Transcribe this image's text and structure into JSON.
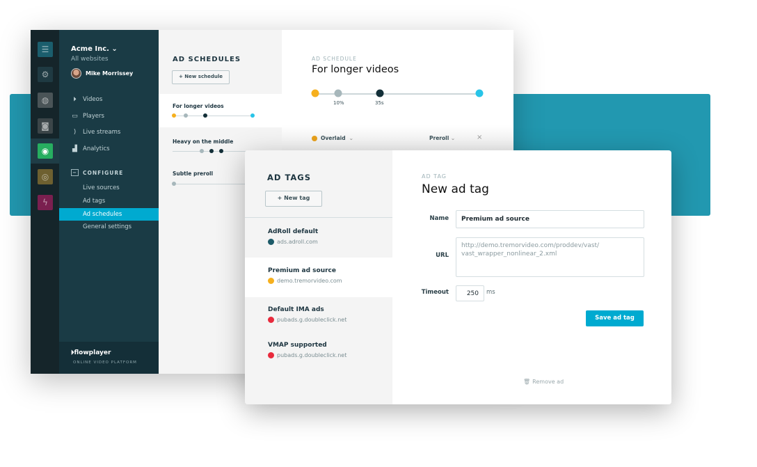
{
  "colors": {
    "accent": "#00aad0",
    "band": "#2298b0",
    "yellow": "#f6b01e",
    "gray": "#a7b7bb",
    "dark": "#132f38",
    "cyan": "#28c4e8",
    "red": "#e82a3c",
    "teal": "#1c5a68"
  },
  "rail": {
    "icons": [
      "menu-icon",
      "gear-icon",
      "player-icon",
      "stream-icon",
      "ads-icon",
      "analytics-icon",
      "lightning-icon"
    ]
  },
  "sidebar": {
    "org": "Acme Inc. ⌄",
    "sub": "All websites",
    "user": "Mike Morrissey",
    "nav": [
      {
        "label": "Videos",
        "icon": "play-icon"
      },
      {
        "label": "Players",
        "icon": "monitor-icon"
      },
      {
        "label": "Live streams",
        "icon": "broadcast-icon"
      },
      {
        "label": "Analytics",
        "icon": "chart-icon"
      }
    ],
    "configure": "CONFIGURE",
    "sub_items": [
      {
        "label": "Live sources"
      },
      {
        "label": "Ad tags"
      },
      {
        "label": "Ad schedules",
        "active": true
      },
      {
        "label": "General settings"
      }
    ],
    "brand": "flowplayer",
    "brand_tag": "ONLINE VIDEO PLATFORM"
  },
  "schedules": {
    "title": "AD SCHEDULES",
    "new_button": "+ New schedule",
    "items": [
      {
        "name": "For longer videos",
        "selected": true
      },
      {
        "name": "Heavy on the middle"
      },
      {
        "name": "Subtle preroll"
      }
    ]
  },
  "schedule_detail": {
    "label": "AD SCHEDULE",
    "title": "For longer videos",
    "marks": [
      "10%",
      "35s"
    ],
    "row": {
      "type": "Overlaid",
      "position": "Preroll"
    }
  },
  "tags": {
    "title": "AD TAGS",
    "new_button": "+ New tag",
    "items": [
      {
        "name": "AdRoll default",
        "domain": "ads.adroll.com",
        "color": "#1c5a68"
      },
      {
        "name": "Premium ad source",
        "domain": "demo.tremorvideo.com",
        "color": "#f6b01e",
        "selected": true
      },
      {
        "name": "Default IMA ads",
        "domain": "pubads.g.doubleclick.net",
        "color": "#e82a3c"
      },
      {
        "name": "VMAP supported",
        "domain": "pubads.g.doubleclick.net",
        "color": "#e82a3c"
      }
    ]
  },
  "tag_form": {
    "label": "AD TAG",
    "title": "New ad tag",
    "name_label": "Name",
    "name_value": "Premium ad source",
    "url_label": "URL",
    "url_value": "http://demo.tremorvideo.com/proddev/vast/\nvast_wrapper_nonlinear_2.xml",
    "timeout_label": "Timeout",
    "timeout_value": "250",
    "timeout_unit": "ms",
    "save": "Save ad tag",
    "remove": "Remove ad"
  }
}
